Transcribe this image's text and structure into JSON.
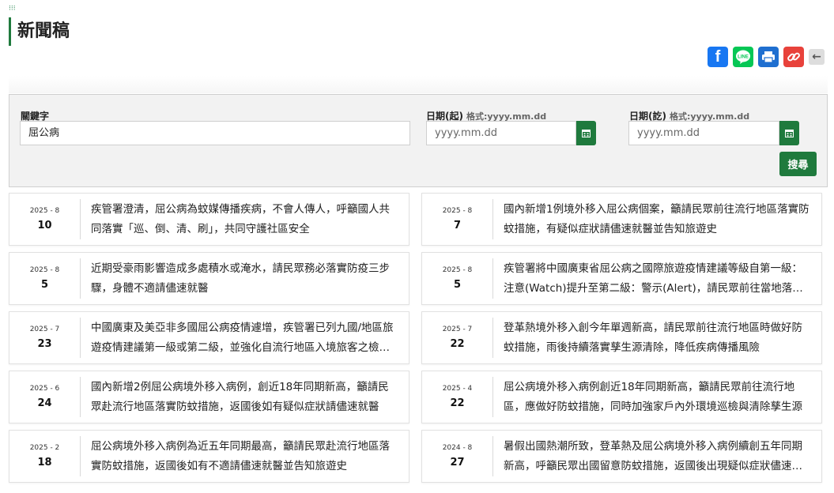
{
  "page": {
    "title": "新聞稿"
  },
  "share": {
    "facebook": "f",
    "line": "LINE",
    "print": "print-icon",
    "link": "link-icon",
    "back": "←"
  },
  "search": {
    "keyword_label": "關鍵字",
    "keyword_value": "屈公病",
    "start_label": "日期(起)",
    "start_hint": "格式:yyyy.mm.dd",
    "start_placeholder": "yyyy.mm.dd",
    "end_label": "日期(訖)",
    "end_hint": "格式:yyyy.mm.dd",
    "end_placeholder": "yyyy.mm.dd",
    "button_label": "搜尋"
  },
  "news": [
    {
      "ym": "2025 - 8",
      "day": "10",
      "text": "疾管署澄清，屈公病為蚊媒傳播疾病，不會人傳人，呼籲國人共同落實「巡、倒、清、刷」，共同守護社區安全"
    },
    {
      "ym": "2025 - 8",
      "day": "7",
      "text": "國內新增1例境外移入屈公病個案，籲請民眾前往流行地區落實防蚊措施，有疑似症狀請儘速就醫並告知旅遊史"
    },
    {
      "ym": "2025 - 8",
      "day": "5",
      "text": "近期受豪雨影響造成多處積水或淹水，請民眾務必落實防疫三步驟，身體不適請儘速就醫"
    },
    {
      "ym": "2025 - 8",
      "day": "5",
      "text": "疾管署將中國廣東省屈公病之國際旅遊疫情建議等級自第一級：注意(Watch)提升至第二級：警示(Alert)，請民眾前往當地落實防蚊措施"
    },
    {
      "ym": "2025 - 7",
      "day": "23",
      "text": "中國廣東及美亞非多國屈公病疫情遽增，疾管署已列九國/地區旅遊疫情建議第一級或第二級，並強化自流行地區入境旅客之檢疫措施"
    },
    {
      "ym": "2025 - 7",
      "day": "22",
      "text": "登革熱境外移入創今年單週新高，請民眾前往流行地區時做好防蚊措施，雨後持續落實孳生源清除，降低疾病傳播風險"
    },
    {
      "ym": "2025 - 6",
      "day": "24",
      "text": "國內新增2例屈公病境外移入病例，創近18年同期新高，籲請民眾赴流行地區落實防蚊措施，返國後如有疑似症狀請儘速就醫"
    },
    {
      "ym": "2025 - 4",
      "day": "22",
      "text": "屈公病境外移入病例創近18年同期新高，籲請民眾前往流行地區，應做好防蚊措施，同時加強家戶內外環境巡檢與清除孳生源"
    },
    {
      "ym": "2025 - 2",
      "day": "18",
      "text": "屈公病境外移入病例為近五年同期最高，籲請民眾赴流行地區落實防蚊措施，返國後如有不適請儘速就醫並告知旅遊史"
    },
    {
      "ym": "2024 - 8",
      "day": "27",
      "text": "暑假出國熱潮所致，登革熱及屈公病境外移入病例續創五年同期新高，呼籲民眾出國留意防蚊措施，返國後出現疑似症狀儘速就醫"
    }
  ]
}
